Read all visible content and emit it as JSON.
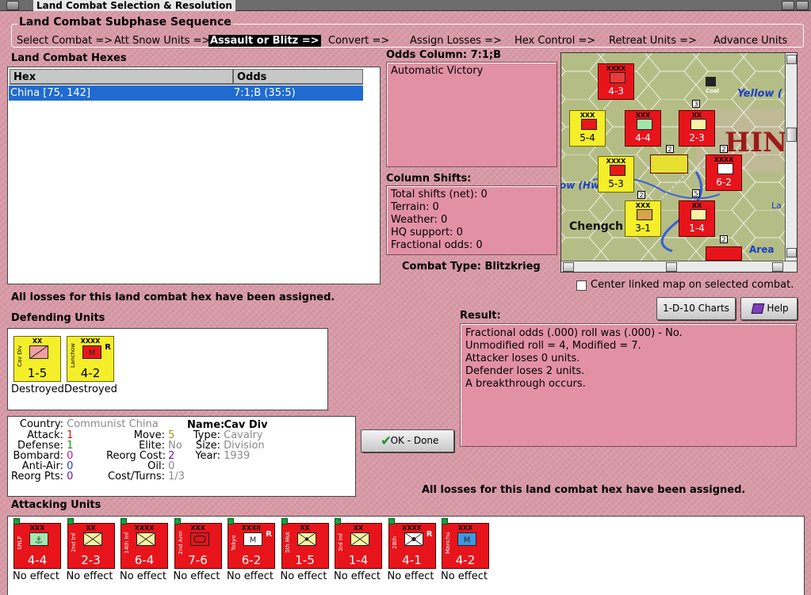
{
  "window": {
    "title": "Land Combat Selection & Resolution"
  },
  "subphase": {
    "title": "Land Combat Subphase Sequence",
    "steps": [
      {
        "label": "Select Combat =>",
        "active": false
      },
      {
        "label": "Att Snow Units =>",
        "active": false
      },
      {
        "label": "Assault or Blitz =>",
        "active": true
      },
      {
        "label": "Convert =>",
        "active": false
      },
      {
        "label": "Assign Losses =>",
        "active": false
      },
      {
        "label": "Hex Control =>",
        "active": false
      },
      {
        "label": "Retreat Units =>",
        "active": false
      },
      {
        "label": "Advance Units",
        "active": false
      }
    ]
  },
  "hexes": {
    "title": "Land Combat Hexes",
    "columns": [
      "Hex",
      "Odds"
    ],
    "rows": [
      {
        "hex": "China [75, 142]",
        "odds": "7:1;B (35:5)"
      }
    ]
  },
  "odds": {
    "title": "Odds Column: 7:1;B",
    "text": "Automatic Victory"
  },
  "shifts": {
    "title": "Column Shifts:",
    "lines": [
      "Total shifts (net): 0",
      "Terrain: 0",
      "Weather: 0",
      "HQ support: 0",
      "Fractional odds: 0"
    ]
  },
  "combat_type": "Combat Type:  Blitzkrieg",
  "map": {
    "labels": {
      "yellow": "Yellow (",
      "chin": "HIN",
      "hwang": "ow (Hw",
      "chengch": "Chengch",
      "area": "Area",
      "la": "La",
      "coal": "Coal"
    },
    "stack_numbers": [
      "3",
      "2",
      "2",
      "5",
      "2",
      "2"
    ],
    "counters": [
      {
        "val": "4-3",
        "size": "XXXX",
        "color": "red"
      },
      {
        "val": "5-4",
        "size": "XXX",
        "color": "yellow"
      },
      {
        "val": "4-4",
        "size": "XXX",
        "color": "red"
      },
      {
        "val": "2-3",
        "size": "XX",
        "color": "red"
      },
      {
        "val": "5-3",
        "size": "XXXX",
        "color": "yellow"
      },
      {
        "val": "6-2",
        "size": "XXXX",
        "color": "red"
      },
      {
        "val": "3-1",
        "size": "XXX",
        "color": "yellow"
      },
      {
        "val": "1-4",
        "size": "XX",
        "color": "red"
      }
    ]
  },
  "center_linked": {
    "label": "Center linked map on selected combat.",
    "checked": false
  },
  "losses_msg": "All losses for this land combat hex have been assigned.",
  "defending": {
    "title": "Defending Units",
    "units": [
      {
        "size": "XX",
        "name": "Cav Div",
        "val": "1-5",
        "status": "Destroyed",
        "color": "yellow",
        "r": ""
      },
      {
        "size": "XXXX",
        "name": "Lanchow",
        "val": "4-2",
        "status": "Destroyed",
        "color": "yellow",
        "r": "R"
      }
    ]
  },
  "details": {
    "country": {
      "label": "Country:",
      "value": "Communist China"
    },
    "attack": {
      "label": "Attack:",
      "value": "1"
    },
    "defense": {
      "label": "Defense:",
      "value": "1"
    },
    "bombard": {
      "label": "Bombard:",
      "value": "0"
    },
    "antiair": {
      "label": "Anti-Air:",
      "value": "0"
    },
    "reorgpts": {
      "label": "Reorg Pts:",
      "value": "0"
    },
    "move": {
      "label": "Move:",
      "value": "5"
    },
    "elite": {
      "label": "Elite:",
      "value": "No"
    },
    "reorgcost": {
      "label": "Reorg Cost:",
      "value": "2"
    },
    "oil": {
      "label": "Oil:",
      "value": "0"
    },
    "costturns": {
      "label": "Cost/Turns:",
      "value": "1/3"
    },
    "name": {
      "label": "Name:",
      "value": "Cav Div"
    },
    "type": {
      "label": "Type:",
      "value": "Cavalry"
    },
    "size": {
      "label": "Size:",
      "value": "Division"
    },
    "year": {
      "label": "Year:",
      "value": "1939"
    }
  },
  "buttons": {
    "charts": "1-D-10 Charts",
    "help": "Help",
    "ok": "OK - Done"
  },
  "result": {
    "title": "Result:",
    "lines": [
      "Fractional odds (.000) roll was (.000)  - No.",
      "Unmodified roll = 4, Modified = 7.",
      "Attacker loses 0 units.",
      "Defender loses 2 units.",
      "A breakthrough occurs."
    ]
  },
  "attacking": {
    "title": "Attacking Units",
    "units": [
      {
        "size": "XXX",
        "name": "SNLF",
        "val": "4-4",
        "status": "No effect",
        "sym": "marine"
      },
      {
        "size": "XX",
        "name": "2nd Inf Div",
        "val": "2-3",
        "status": "No effect",
        "sym": "inf"
      },
      {
        "size": "XXXX",
        "name": "14th Inf",
        "val": "6-4",
        "status": "No effect",
        "sym": "inf"
      },
      {
        "size": "XXX",
        "name": "2nd Arm",
        "val": "7-6",
        "status": "No effect",
        "sym": "arm"
      },
      {
        "size": "XXXX",
        "name": "Tokyo",
        "val": "6-2",
        "status": "No effect",
        "sym": "mech",
        "r": "R"
      },
      {
        "size": "XX",
        "name": "5th Mot Div",
        "val": "1-5",
        "status": "No effect",
        "sym": "mot"
      },
      {
        "size": "XX",
        "name": "3rd Inf Div",
        "val": "1-4",
        "status": "No effect",
        "sym": "inf"
      },
      {
        "size": "XXXX",
        "name": "28th Garr",
        "val": "4-1",
        "status": "No effect",
        "sym": "garr",
        "r": "R"
      },
      {
        "size": "XXX",
        "name": "Manchu",
        "val": "4-2",
        "status": "No effect",
        "sym": "mechblue"
      }
    ]
  }
}
